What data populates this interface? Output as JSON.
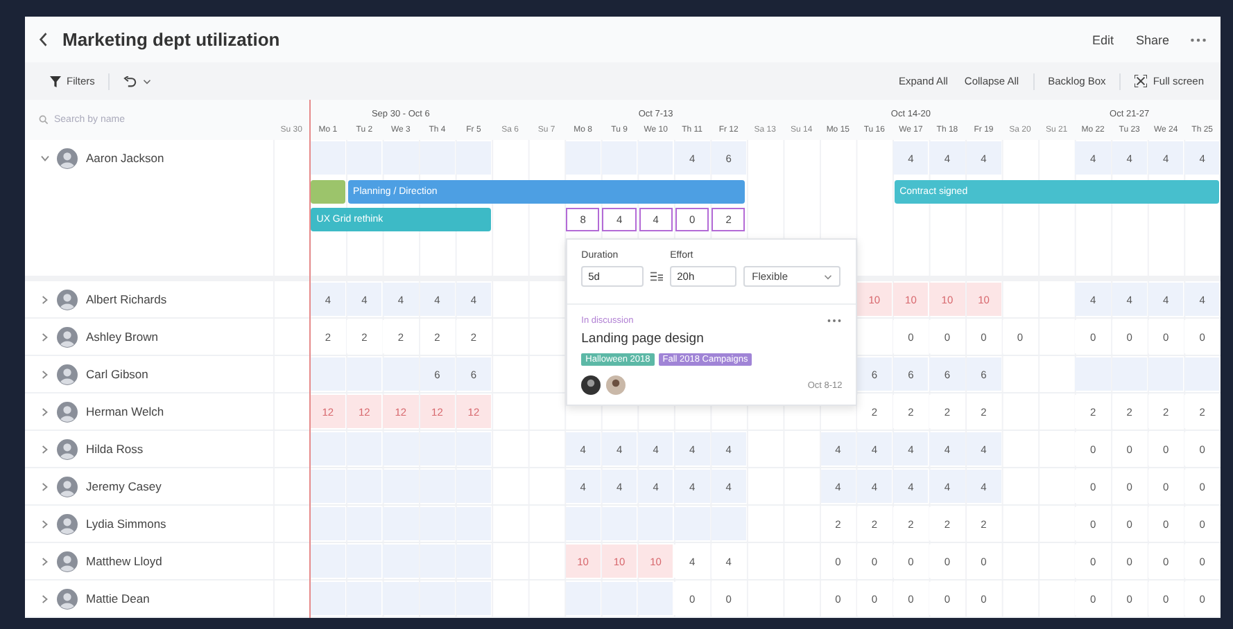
{
  "header": {
    "title": "Marketing dept utilization",
    "actions": [
      "Edit",
      "Share"
    ]
  },
  "toolbar": {
    "filters": "Filters",
    "actions": [
      {
        "label": "Expand All",
        "divider_before": false,
        "kind": "text"
      },
      {
        "label": "Collapse All",
        "divider_before": false,
        "kind": "text"
      },
      {
        "label": "Backlog Box",
        "divider_before": true,
        "kind": "text"
      },
      {
        "label": "Full screen",
        "divider_before": true,
        "kind": "fullscreen"
      }
    ]
  },
  "search": {
    "placeholder": "Search by name"
  },
  "weeks": [
    {
      "label": "Sep 30 - Oct 6",
      "days": [
        {
          "label": "Su 30",
          "weekend": true
        },
        {
          "label": "Mo 1",
          "weekend": false
        },
        {
          "label": "Tu 2",
          "weekend": false
        },
        {
          "label": "We 3",
          "weekend": false
        },
        {
          "label": "Th 4",
          "weekend": false
        },
        {
          "label": "Fr 5",
          "weekend": false
        },
        {
          "label": "Sa 6",
          "weekend": true
        }
      ]
    },
    {
      "label": "Oct 7-13",
      "days": [
        {
          "label": "Su 7",
          "weekend": true
        },
        {
          "label": "Mo 8",
          "weekend": false
        },
        {
          "label": "Tu 9",
          "weekend": false
        },
        {
          "label": "We 10",
          "weekend": false
        },
        {
          "label": "Th 11",
          "weekend": false
        },
        {
          "label": "Fr 12",
          "weekend": false
        },
        {
          "label": "Sa 13",
          "weekend": true
        }
      ]
    },
    {
      "label": "Oct 14-20",
      "days": [
        {
          "label": "Su 14",
          "weekend": true
        },
        {
          "label": "Mo 15",
          "weekend": false
        },
        {
          "label": "Tu 16",
          "weekend": false
        },
        {
          "label": "We 17",
          "weekend": false
        },
        {
          "label": "Th 18",
          "weekend": false
        },
        {
          "label": "Fr 19",
          "weekend": false
        },
        {
          "label": "Sa 20",
          "weekend": true
        }
      ]
    },
    {
      "label": "Oct 21-27",
      "days": [
        {
          "label": "Su 21",
          "weekend": true
        },
        {
          "label": "Mo 22",
          "weekend": false
        },
        {
          "label": "Tu 23",
          "weekend": false
        },
        {
          "label": "We 24",
          "weekend": false
        },
        {
          "label": "Th 25",
          "weekend": false
        }
      ]
    }
  ],
  "people": [
    {
      "name": "Aaron Jackson",
      "expanded": true,
      "cells": [
        null,
        {
          "kind": "shade"
        },
        {
          "kind": "shade"
        },
        {
          "kind": "shade"
        },
        {
          "kind": "shade"
        },
        {
          "kind": "shade"
        },
        null,
        null,
        {
          "kind": "shade"
        },
        {
          "kind": "shade"
        },
        {
          "kind": "shade"
        },
        {
          "kind": "blue",
          "text": "4"
        },
        {
          "kind": "blue",
          "text": "6"
        },
        null,
        null,
        null,
        null,
        {
          "kind": "blue",
          "text": "4"
        },
        {
          "kind": "blue",
          "text": "4"
        },
        {
          "kind": "blue",
          "text": "4"
        },
        null,
        null,
        {
          "kind": "blue",
          "text": "4"
        },
        {
          "kind": "blue",
          "text": "4"
        },
        {
          "kind": "blue",
          "text": "4"
        },
        {
          "kind": "blue",
          "text": "4"
        }
      ],
      "lanes": [
        [
          {
            "kind": "bar",
            "color": "#9cc46b"
          },
          {
            "kind": "bar",
            "label": "Planning / Direction",
            "color": "#4d9fe3"
          },
          {
            "kind": "bar",
            "label": "Contract signed",
            "color": "#47bfcd"
          }
        ],
        [
          {
            "kind": "bar",
            "label": "UX Grid rethink",
            "color": "#3dbac6"
          },
          {
            "kind": "inputs",
            "values": [
              "8",
              "4",
              "4",
              "0",
              "2"
            ]
          }
        ]
      ]
    },
    {
      "name": "Albert Richards",
      "expanded": false,
      "cells": [
        null,
        {
          "kind": "blue",
          "text": "4"
        },
        {
          "kind": "blue",
          "text": "4"
        },
        {
          "kind": "blue",
          "text": "4"
        },
        {
          "kind": "blue",
          "text": "4"
        },
        {
          "kind": "blue",
          "text": "4"
        },
        null,
        null,
        null,
        null,
        null,
        null,
        null,
        null,
        null,
        null,
        {
          "kind": "over",
          "text": "10"
        },
        {
          "kind": "over",
          "text": "10"
        },
        {
          "kind": "over",
          "text": "10"
        },
        {
          "kind": "over",
          "text": "10"
        },
        null,
        null,
        {
          "kind": "blue",
          "text": "4"
        },
        {
          "kind": "blue",
          "text": "4"
        },
        {
          "kind": "blue",
          "text": "4"
        },
        {
          "kind": "blue",
          "text": "4"
        }
      ]
    },
    {
      "name": "Ashley Brown",
      "expanded": false,
      "cells": [
        null,
        {
          "kind": "plain",
          "text": "2"
        },
        {
          "kind": "plain",
          "text": "2"
        },
        {
          "kind": "plain",
          "text": "2"
        },
        {
          "kind": "plain",
          "text": "2"
        },
        {
          "kind": "plain",
          "text": "2"
        },
        null,
        null,
        null,
        null,
        null,
        null,
        null,
        null,
        null,
        null,
        null,
        {
          "kind": "plain",
          "text": "0"
        },
        {
          "kind": "plain",
          "text": "0"
        },
        {
          "kind": "plain",
          "text": "0"
        },
        {
          "kind": "plain",
          "text": "0"
        },
        null,
        {
          "kind": "plain",
          "text": "0"
        },
        {
          "kind": "plain",
          "text": "0"
        },
        {
          "kind": "plain",
          "text": "0"
        },
        {
          "kind": "plain",
          "text": "0"
        }
      ]
    },
    {
      "name": "Carl Gibson",
      "expanded": false,
      "cells": [
        null,
        {
          "kind": "shade"
        },
        {
          "kind": "shade"
        },
        {
          "kind": "shade"
        },
        {
          "kind": "blue",
          "text": "6"
        },
        {
          "kind": "blue",
          "text": "6"
        },
        null,
        null,
        null,
        null,
        null,
        null,
        null,
        null,
        null,
        null,
        {
          "kind": "blue",
          "text": "6"
        },
        {
          "kind": "blue",
          "text": "6"
        },
        {
          "kind": "blue",
          "text": "6"
        },
        {
          "kind": "blue",
          "text": "6"
        },
        null,
        null,
        {
          "kind": "shade"
        },
        {
          "kind": "shade"
        },
        {
          "kind": "shade"
        },
        {
          "kind": "shade"
        }
      ]
    },
    {
      "name": "Herman Welch",
      "expanded": false,
      "cells": [
        null,
        {
          "kind": "over",
          "text": "12"
        },
        {
          "kind": "over",
          "text": "12"
        },
        {
          "kind": "over",
          "text": "12"
        },
        {
          "kind": "over",
          "text": "12"
        },
        {
          "kind": "over",
          "text": "12"
        },
        null,
        null,
        null,
        null,
        null,
        null,
        null,
        null,
        null,
        null,
        {
          "kind": "plain",
          "text": "2"
        },
        {
          "kind": "plain",
          "text": "2"
        },
        {
          "kind": "plain",
          "text": "2"
        },
        {
          "kind": "plain",
          "text": "2"
        },
        null,
        null,
        {
          "kind": "plain",
          "text": "2"
        },
        {
          "kind": "plain",
          "text": "2"
        },
        {
          "kind": "plain",
          "text": "2"
        },
        {
          "kind": "plain",
          "text": "2"
        }
      ]
    },
    {
      "name": "Hilda Ross",
      "expanded": false,
      "cells": [
        null,
        {
          "kind": "shade"
        },
        {
          "kind": "shade"
        },
        {
          "kind": "shade"
        },
        {
          "kind": "shade"
        },
        {
          "kind": "shade"
        },
        null,
        null,
        {
          "kind": "blue",
          "text": "4"
        },
        {
          "kind": "blue",
          "text": "4"
        },
        {
          "kind": "blue",
          "text": "4"
        },
        {
          "kind": "blue",
          "text": "4"
        },
        {
          "kind": "blue",
          "text": "4"
        },
        null,
        null,
        {
          "kind": "blue",
          "text": "4"
        },
        {
          "kind": "blue",
          "text": "4"
        },
        {
          "kind": "blue",
          "text": "4"
        },
        {
          "kind": "blue",
          "text": "4"
        },
        {
          "kind": "blue",
          "text": "4"
        },
        null,
        null,
        {
          "kind": "plain",
          "text": "0"
        },
        {
          "kind": "plain",
          "text": "0"
        },
        {
          "kind": "plain",
          "text": "0"
        },
        {
          "kind": "plain",
          "text": "0"
        }
      ]
    },
    {
      "name": "Jeremy Casey",
      "expanded": false,
      "cells": [
        null,
        {
          "kind": "shade"
        },
        {
          "kind": "shade"
        },
        {
          "kind": "shade"
        },
        {
          "kind": "shade"
        },
        {
          "kind": "shade"
        },
        null,
        null,
        {
          "kind": "blue",
          "text": "4"
        },
        {
          "kind": "blue",
          "text": "4"
        },
        {
          "kind": "blue",
          "text": "4"
        },
        {
          "kind": "blue",
          "text": "4"
        },
        {
          "kind": "blue",
          "text": "4"
        },
        null,
        null,
        {
          "kind": "blue",
          "text": "4"
        },
        {
          "kind": "blue",
          "text": "4"
        },
        {
          "kind": "blue",
          "text": "4"
        },
        {
          "kind": "blue",
          "text": "4"
        },
        {
          "kind": "blue",
          "text": "4"
        },
        null,
        null,
        {
          "kind": "plain",
          "text": "0"
        },
        {
          "kind": "plain",
          "text": "0"
        },
        {
          "kind": "plain",
          "text": "0"
        },
        {
          "kind": "plain",
          "text": "0"
        }
      ]
    },
    {
      "name": "Lydia Simmons",
      "expanded": false,
      "cells": [
        null,
        {
          "kind": "shade"
        },
        {
          "kind": "shade"
        },
        {
          "kind": "shade"
        },
        {
          "kind": "shade"
        },
        {
          "kind": "shade"
        },
        null,
        null,
        {
          "kind": "shade"
        },
        {
          "kind": "shade"
        },
        {
          "kind": "shade"
        },
        {
          "kind": "shade"
        },
        {
          "kind": "shade"
        },
        null,
        null,
        {
          "kind": "plain",
          "text": "2"
        },
        {
          "kind": "plain",
          "text": "2"
        },
        {
          "kind": "plain",
          "text": "2"
        },
        {
          "kind": "plain",
          "text": "2"
        },
        {
          "kind": "plain",
          "text": "2"
        },
        null,
        null,
        {
          "kind": "plain",
          "text": "0"
        },
        {
          "kind": "plain",
          "text": "0"
        },
        {
          "kind": "plain",
          "text": "0"
        },
        {
          "kind": "plain",
          "text": "0"
        }
      ]
    },
    {
      "name": "Matthew Lloyd",
      "expanded": false,
      "cells": [
        null,
        {
          "kind": "shade"
        },
        {
          "kind": "shade"
        },
        {
          "kind": "shade"
        },
        {
          "kind": "shade"
        },
        {
          "kind": "shade"
        },
        null,
        null,
        {
          "kind": "over",
          "text": "10"
        },
        {
          "kind": "over",
          "text": "10"
        },
        {
          "kind": "over",
          "text": "10"
        },
        {
          "kind": "plain",
          "text": "4"
        },
        {
          "kind": "plain",
          "text": "4"
        },
        null,
        null,
        {
          "kind": "plain",
          "text": "0"
        },
        {
          "kind": "plain",
          "text": "0"
        },
        {
          "kind": "plain",
          "text": "0"
        },
        {
          "kind": "plain",
          "text": "0"
        },
        {
          "kind": "plain",
          "text": "0"
        },
        null,
        null,
        {
          "kind": "plain",
          "text": "0"
        },
        {
          "kind": "plain",
          "text": "0"
        },
        {
          "kind": "plain",
          "text": "0"
        },
        {
          "kind": "plain",
          "text": "0"
        }
      ]
    },
    {
      "name": "Mattie Dean",
      "expanded": false,
      "cells": [
        null,
        {
          "kind": "shade"
        },
        {
          "kind": "shade"
        },
        {
          "kind": "shade"
        },
        {
          "kind": "shade"
        },
        {
          "kind": "shade"
        },
        null,
        null,
        {
          "kind": "shade"
        },
        {
          "kind": "shade"
        },
        {
          "kind": "shade"
        },
        {
          "kind": "plain",
          "text": "0"
        },
        {
          "kind": "plain",
          "text": "0"
        },
        null,
        null,
        {
          "kind": "plain",
          "text": "0"
        },
        {
          "kind": "plain",
          "text": "0"
        },
        {
          "kind": "plain",
          "text": "0"
        },
        {
          "kind": "plain",
          "text": "0"
        },
        {
          "kind": "plain",
          "text": "0"
        },
        null,
        null,
        {
          "kind": "plain",
          "text": "0"
        },
        {
          "kind": "plain",
          "text": "0"
        },
        {
          "kind": "plain",
          "text": "0"
        },
        {
          "kind": "plain",
          "text": "0"
        }
      ]
    }
  ],
  "popover": {
    "duration": {
      "label": "Duration",
      "value": "5d"
    },
    "effort": {
      "label": "Effort",
      "value": "20h"
    },
    "mode": "Flexible",
    "status": "In discussion",
    "title": "Landing page design",
    "tags": [
      {
        "label": "Halloween 2018",
        "color": "#5cb8a6"
      },
      {
        "label": "Fall 2018 Campaigns",
        "color": "#a084d6"
      }
    ],
    "date": "Oct 8-12"
  }
}
